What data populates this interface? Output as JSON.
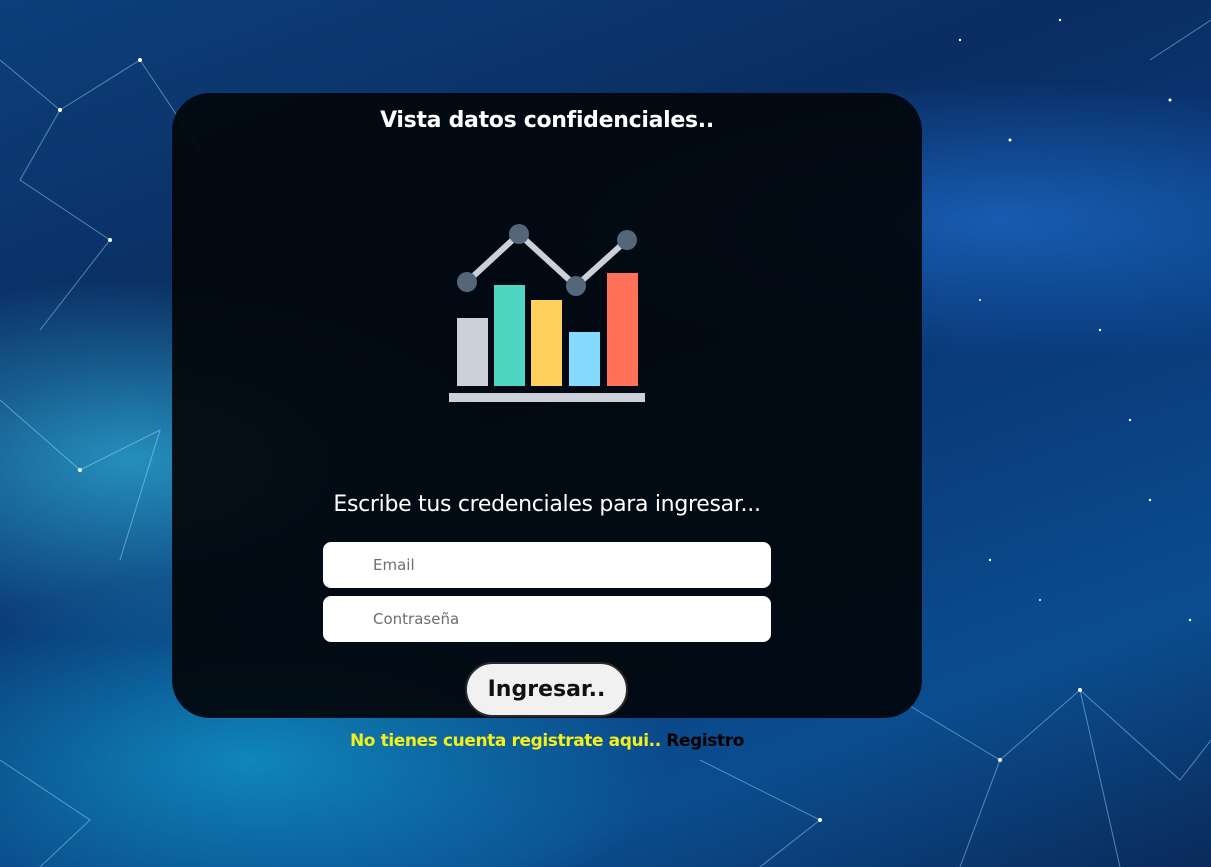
{
  "header": {
    "title": "Vista datos confidenciales.."
  },
  "hero": {
    "icon": "bar-line-chart-icon"
  },
  "login": {
    "subtitle": "Escribe tus credenciales para ingresar...",
    "email_placeholder": "Email",
    "password_placeholder": "Contraseña",
    "submit_label": "Ingresar.."
  },
  "register": {
    "prompt": "No tienes cuenta registrate aqui..",
    "link_label": "Registro"
  },
  "colors": {
    "card_bg": "#02060c",
    "prompt_yellow": "#f5f01a",
    "bar_gray": "#ccd0da",
    "bar_teal": "#4fd6c3",
    "bar_yellow": "#ffd15c",
    "bar_blue": "#84dbff",
    "bar_red": "#ff7058",
    "node_slate": "#54667a"
  }
}
